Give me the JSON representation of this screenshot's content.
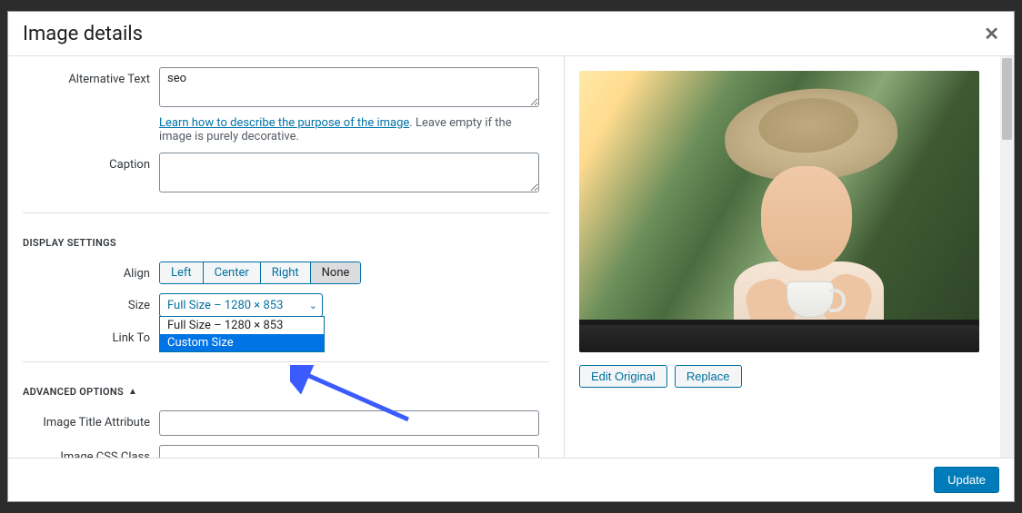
{
  "modal": {
    "title": "Image details",
    "close_glyph": "✕"
  },
  "form": {
    "alt_text_label": "Alternative Text",
    "alt_text_value": "seo",
    "alt_help_link": "Learn how to describe the purpose of the image",
    "alt_help_rest": ". Leave empty if the image is purely decorative.",
    "caption_label": "Caption",
    "caption_value": ""
  },
  "display_settings": {
    "heading": "DISPLAY SETTINGS",
    "align_label": "Align",
    "align_options": {
      "left": "Left",
      "center": "Center",
      "right": "Right",
      "none": "None"
    },
    "size_label": "Size",
    "size_selected": "Full Size – 1280 × 853",
    "size_options": {
      "full": "Full Size – 1280 × 853",
      "custom": "Custom Size"
    },
    "link_to_label": "Link To"
  },
  "advanced": {
    "heading": "ADVANCED OPTIONS",
    "image_title_label": "Image Title Attribute",
    "image_title_value": "",
    "image_css_label": "Image CSS Class",
    "image_css_value": ""
  },
  "preview": {
    "edit_original": "Edit Original",
    "replace": "Replace"
  },
  "footer": {
    "update": "Update"
  },
  "icons": {
    "chevron_down": "⌄",
    "triangle_up": "▲"
  }
}
